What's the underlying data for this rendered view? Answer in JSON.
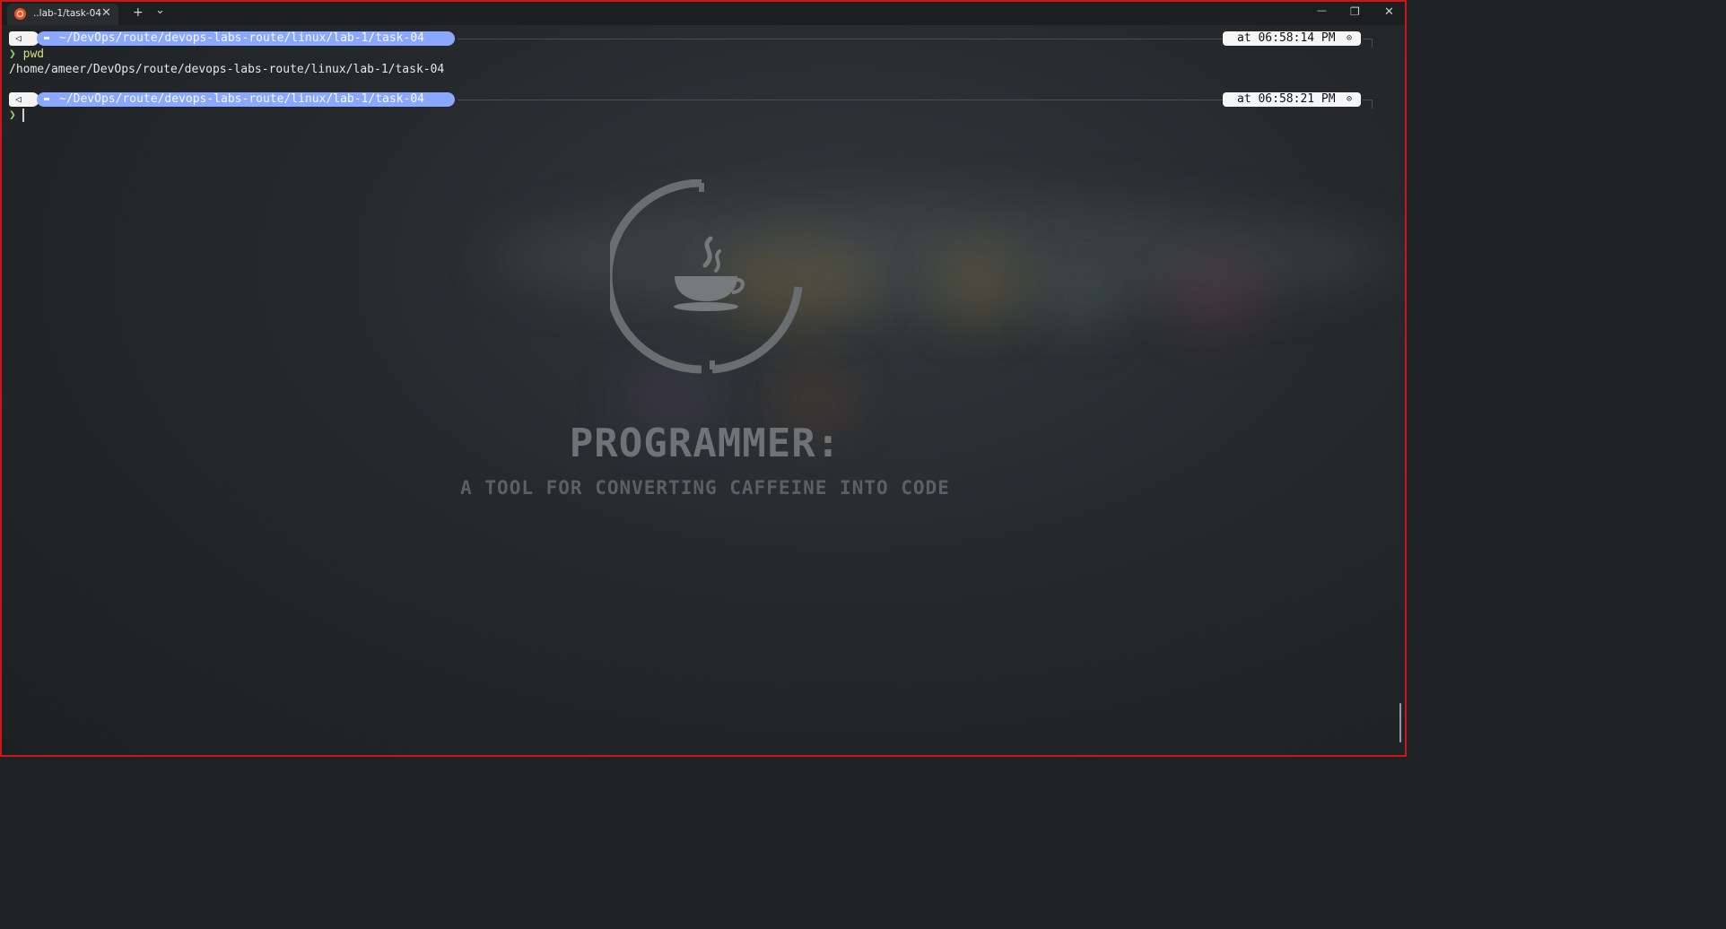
{
  "colors": {
    "window_border": "#c8181e",
    "path_segment": "#8aa8ff",
    "prompt_chevron": "#8fd16a",
    "command_text": "#cfe27a",
    "ubuntu_orange": "#e95420"
  },
  "titlebar": {
    "tab_title": "..lab-1/task-04",
    "tab_icon": "ubuntu-icon",
    "close_glyph": "✕",
    "new_tab_glyph": "+",
    "dropdown_glyph": "⌄",
    "minimize_glyph": "—",
    "maximize_glyph": "❐",
    "window_close_glyph": "✕"
  },
  "terminal": {
    "prompts": [
      {
        "os_glyph": "◁",
        "folder_glyph": "▬",
        "path": "~/DevOps/route/devops-labs-route/linux/lab-1/task-04",
        "time": "at 06:58:14 PM",
        "clock_glyph": "⊙"
      },
      {
        "os_glyph": "◁",
        "folder_glyph": "▬",
        "path": "~/DevOps/route/devops-labs-route/linux/lab-1/task-04",
        "time": "at 06:58:21 PM",
        "clock_glyph": "⊙"
      }
    ],
    "chevron": "❯",
    "command": "pwd",
    "output": "/home/ameer/DevOps/route/devops-labs-route/linux/lab-1/task-04"
  },
  "wallpaper": {
    "title": "PROGRAMMER:",
    "subtitle": "A TOOL FOR CONVERTING CAFFEINE INTO CODE",
    "icon": "coffee-cup-icon"
  }
}
